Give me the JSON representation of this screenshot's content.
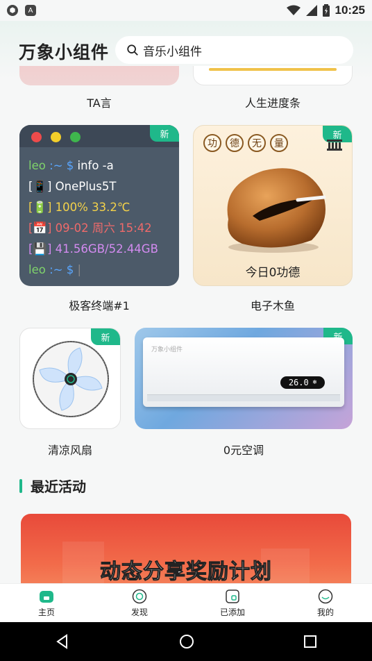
{
  "status_bar": {
    "time": "10:25",
    "left_icons": [
      "app-notification-icon",
      "a-notification-icon"
    ],
    "right_icons": [
      "wifi-icon",
      "signal-icon",
      "battery-icon"
    ]
  },
  "header": {
    "title": "万象小组件",
    "search_placeholder": "音乐小组件"
  },
  "widgets_top": [
    {
      "label": "TA言"
    },
    {
      "label": "人生进度条"
    }
  ],
  "terminal": {
    "badge": "新",
    "label": "极客终端#1",
    "lines": {
      "prompt_user": "leo",
      "prompt_path": ":~ $",
      "command": "info -a",
      "device": "OnePlus5T",
      "battery": "100% 33.2℃",
      "datetime": "09-02 周六 15:42",
      "storage": "41.56GB/52.44GB",
      "cursor": "|"
    },
    "colors": {
      "user": "#7fd36b",
      "path": "#5aa7ff",
      "battery": "#f4d24a",
      "datetime": "#f06a6a",
      "storage": "#d38bf0",
      "device": "#ffffff"
    }
  },
  "wooden_fish": {
    "badge": "新",
    "label": "电子木鱼",
    "merit_chars": [
      "功",
      "德",
      "无",
      "量"
    ],
    "merit_text": "今日0功德"
  },
  "fan": {
    "badge": "新",
    "label": "清凉风扇"
  },
  "ac": {
    "badge": "新",
    "label": "0元空调",
    "brand": "万象小组件",
    "temperature": "26.0"
  },
  "section": {
    "title": "最近活动"
  },
  "banner": {
    "title": "动态分享奖励计划"
  },
  "bottom_nav": [
    {
      "label": "主页",
      "icon": "home-icon",
      "active": true
    },
    {
      "label": "发现",
      "icon": "discover-icon",
      "active": false
    },
    {
      "label": "已添加",
      "icon": "added-icon",
      "active": false
    },
    {
      "label": "我的",
      "icon": "profile-icon",
      "active": false
    }
  ],
  "accent_color": "#1fb88a"
}
